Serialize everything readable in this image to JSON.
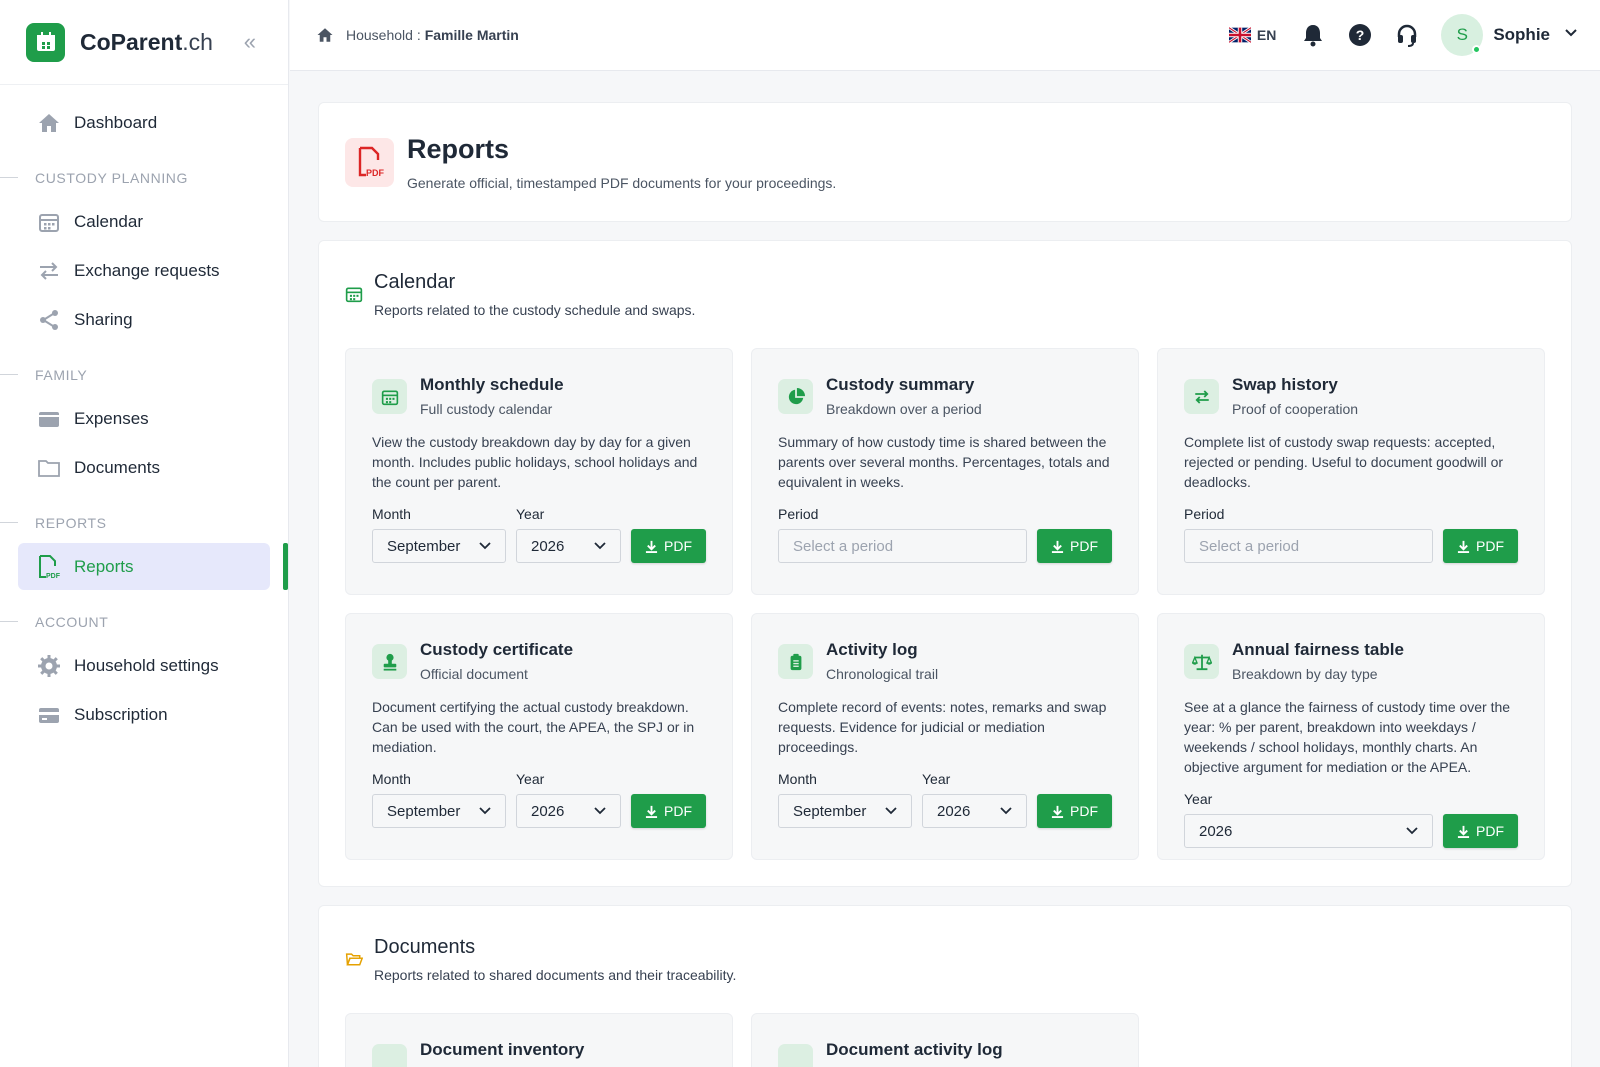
{
  "app": {
    "brand_main": "CoParent",
    "brand_tld": ".ch"
  },
  "sidebar": {
    "dashboard": "Dashboard",
    "sections": {
      "custody": "CUSTODY PLANNING",
      "family": "FAMILY",
      "reports": "REPORTS",
      "account": "ACCOUNT"
    },
    "items": {
      "calendar": "Calendar",
      "exchange": "Exchange requests",
      "sharing": "Sharing",
      "expenses": "Expenses",
      "documents": "Documents",
      "reports": "Reports",
      "household": "Household settings",
      "subscription": "Subscription"
    }
  },
  "topbar": {
    "breadcrumb_label": "Household :",
    "breadcrumb_value": "Famille Martin",
    "language": "EN",
    "user_initial": "S",
    "user_name": "Sophie"
  },
  "page": {
    "title": "Reports",
    "subtitle": "Generate official, timestamped PDF documents for your proceedings."
  },
  "calendar_section": {
    "title": "Calendar",
    "subtitle": "Reports related to the custody schedule and swaps.",
    "cards": [
      {
        "title": "Monthly schedule",
        "subtitle": "Full custody calendar",
        "desc": "View the custody breakdown day by day for a given month. Includes public holidays, school holidays and the count per parent.",
        "month_label": "Month",
        "month_value": "September",
        "year_label": "Year",
        "year_value": "2026",
        "button": "PDF"
      },
      {
        "title": "Custody summary",
        "subtitle": "Breakdown over a period",
        "desc": "Summary of how custody time is shared between the parents over several months. Percentages, totals and equivalent in weeks.",
        "period_label": "Period",
        "period_placeholder": "Select a period",
        "button": "PDF"
      },
      {
        "title": "Swap history",
        "subtitle": "Proof of cooperation",
        "desc": "Complete list of custody swap requests: accepted, rejected or pending. Useful to document goodwill or deadlocks.",
        "period_label": "Period",
        "period_placeholder": "Select a period",
        "button": "PDF"
      },
      {
        "title": "Custody certificate",
        "subtitle": "Official document",
        "desc": "Document certifying the actual custody breakdown. Can be used with the court, the APEA, the SPJ or in mediation.",
        "month_label": "Month",
        "month_value": "September",
        "year_label": "Year",
        "year_value": "2026",
        "button": "PDF"
      },
      {
        "title": "Activity log",
        "subtitle": "Chronological trail",
        "desc": "Complete record of events: notes, remarks and swap requests. Evidence for judicial or mediation proceedings.",
        "month_label": "Month",
        "month_value": "September",
        "year_label": "Year",
        "year_value": "2026",
        "button": "PDF"
      },
      {
        "title": "Annual fairness table",
        "subtitle": "Breakdown by day type",
        "desc": "See at a glance the fairness of custody time over the year: % per parent, breakdown into weekdays / weekends / school holidays, monthly charts. An objective argument for mediation or the APEA.",
        "year_label": "Year",
        "year_value": "2026",
        "button": "PDF"
      }
    ]
  },
  "documents_section": {
    "title": "Documents",
    "subtitle": "Reports related to shared documents and their traceability.",
    "cards": [
      {
        "title": "Document inventory"
      },
      {
        "title": "Document activity log"
      }
    ]
  },
  "colors": {
    "accent": "#1f9d4a",
    "pdf_red": "#dc2626",
    "active_bg": "#e6e8fb"
  }
}
